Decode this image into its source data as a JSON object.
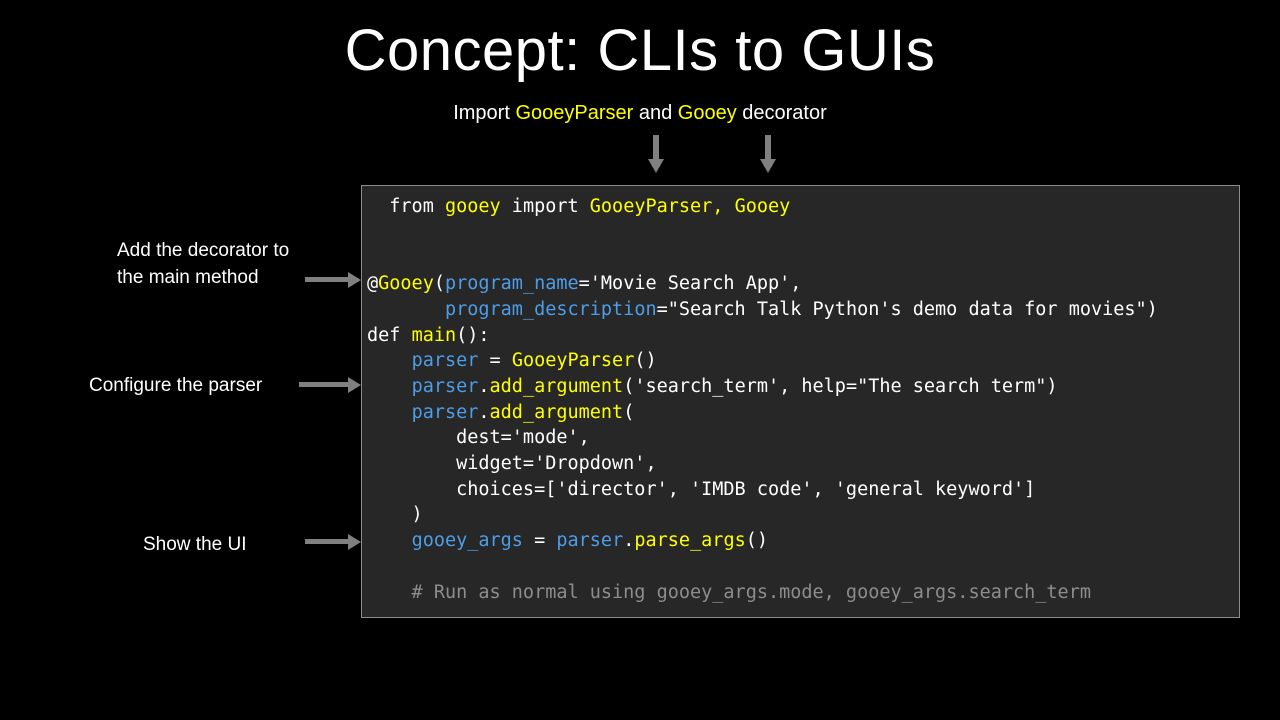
{
  "slide": {
    "title": "Concept: CLIs to GUIs",
    "background_color": "#000000"
  },
  "top_callout": {
    "prefix": "Import ",
    "highlight_1": "GooeyParser",
    "middle": " and ",
    "highlight_2": "Gooey",
    "suffix": " decorator",
    "highlight_color": "#ffff00",
    "text_color": "#ffffff"
  },
  "annotations": [
    {
      "id": "decorator",
      "text": "Add the decorator to\nthe main method"
    },
    {
      "id": "parser",
      "text": "Configure the parser"
    },
    {
      "id": "showui",
      "text": "Show the UI"
    }
  ],
  "arrows": {
    "color": "#808080",
    "down": [
      {
        "name": "arrow-to-gooeyparser"
      },
      {
        "name": "arrow-to-gooey"
      }
    ],
    "right": [
      {
        "name": "arrow-to-decorator-line"
      },
      {
        "name": "arrow-to-parser-lines"
      },
      {
        "name": "arrow-to-parse-args-line"
      }
    ]
  },
  "code_panel": {
    "background_color": "#272727",
    "border_color": "#8c8c8c",
    "language": "python",
    "colors": {
      "plain": "#ffffff",
      "name": "#ffff00",
      "param": "#4d9de8",
      "comment": "#8d8d8d"
    },
    "lines": [
      [
        {
          "t": "  from ",
          "c": "pln"
        },
        {
          "t": "gooey",
          "c": "yel"
        },
        {
          "t": " import ",
          "c": "pln"
        },
        {
          "t": "GooeyParser, Gooey",
          "c": "yel"
        }
      ],
      [
        {
          "t": "",
          "c": "pln"
        }
      ],
      [
        {
          "t": "",
          "c": "pln"
        }
      ],
      [
        {
          "t": "@",
          "c": "pln"
        },
        {
          "t": "Gooey",
          "c": "yel"
        },
        {
          "t": "(",
          "c": "pln"
        },
        {
          "t": "program_name",
          "c": "blu"
        },
        {
          "t": "='Movie Search App',",
          "c": "pln"
        }
      ],
      [
        {
          "t": "       ",
          "c": "pln"
        },
        {
          "t": "program_description",
          "c": "blu"
        },
        {
          "t": "=\"Search Talk Python's demo data for movies\")",
          "c": "pln"
        }
      ],
      [
        {
          "t": "def ",
          "c": "pln"
        },
        {
          "t": "main",
          "c": "yel"
        },
        {
          "t": "():",
          "c": "pln"
        }
      ],
      [
        {
          "t": "    ",
          "c": "pln"
        },
        {
          "t": "parser",
          "c": "blu"
        },
        {
          "t": " = ",
          "c": "pln"
        },
        {
          "t": "GooeyParser",
          "c": "yel"
        },
        {
          "t": "()",
          "c": "pln"
        }
      ],
      [
        {
          "t": "    ",
          "c": "pln"
        },
        {
          "t": "parser",
          "c": "blu"
        },
        {
          "t": ".",
          "c": "pln"
        },
        {
          "t": "add_argument",
          "c": "yel"
        },
        {
          "t": "('search_term', help=\"The search term\")",
          "c": "pln"
        }
      ],
      [
        {
          "t": "    ",
          "c": "pln"
        },
        {
          "t": "parser",
          "c": "blu"
        },
        {
          "t": ".",
          "c": "pln"
        },
        {
          "t": "add_argument",
          "c": "yel"
        },
        {
          "t": "(",
          "c": "pln"
        }
      ],
      [
        {
          "t": "        dest='mode',",
          "c": "pln"
        }
      ],
      [
        {
          "t": "        widget='Dropdown',",
          "c": "pln"
        }
      ],
      [
        {
          "t": "        choices=['director', 'IMDB code', 'general keyword']",
          "c": "pln"
        }
      ],
      [
        {
          "t": "    )",
          "c": "pln"
        }
      ],
      [
        {
          "t": "    ",
          "c": "pln"
        },
        {
          "t": "gooey_args",
          "c": "blu"
        },
        {
          "t": " = ",
          "c": "pln"
        },
        {
          "t": "parser",
          "c": "blu"
        },
        {
          "t": ".",
          "c": "pln"
        },
        {
          "t": "parse_args",
          "c": "yel"
        },
        {
          "t": "()",
          "c": "pln"
        }
      ],
      [
        {
          "t": "",
          "c": "pln"
        }
      ],
      [
        {
          "t": "    # Run as normal using gooey_args.mode, gooey_args.search_term",
          "c": "cmt"
        }
      ]
    ]
  }
}
